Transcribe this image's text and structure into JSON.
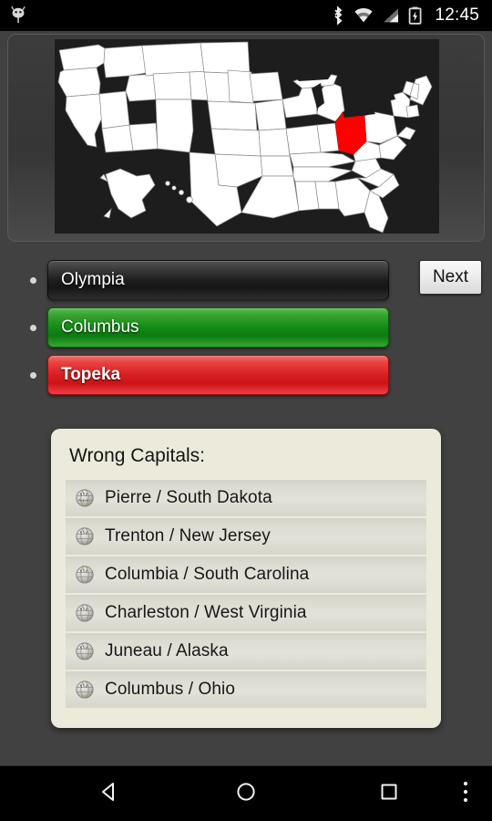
{
  "status_bar": {
    "notification_icon": "android-robot-icon",
    "icons": [
      "bluetooth-icon",
      "wifi-icon",
      "cellular-signal-icon",
      "battery-charging-icon"
    ],
    "clock": "12:45"
  },
  "map": {
    "name": "us-states-map",
    "highlighted_state": "Ohio",
    "highlight_color": "#FF0000",
    "state_fill": "#FFFFFF",
    "state_border": "#8a8a8a",
    "background_color": "#1d1d1d"
  },
  "answers": [
    {
      "label": "Olympia",
      "state": "neutral"
    },
    {
      "label": "Columbus",
      "state": "correct"
    },
    {
      "label": "Topeka",
      "state": "wrong"
    }
  ],
  "next_button": {
    "label": "Next"
  },
  "wrong_capitals": {
    "title": "Wrong Capitals:",
    "items": [
      {
        "label": "Pierre / South Dakota"
      },
      {
        "label": "Trenton / New Jersey"
      },
      {
        "label": "Columbia / South Carolina"
      },
      {
        "label": "Charleston / West Virginia"
      },
      {
        "label": "Juneau / Alaska"
      },
      {
        "label": "Columbus / Ohio"
      }
    ],
    "item_icon": "wikipedia-globe-icon"
  },
  "navigation_bar": {
    "back": "back-icon",
    "home": "home-icon",
    "recents": "recents-icon",
    "menu": "overflow-menu-icon"
  },
  "colors": {
    "background": "#414141",
    "panel": "#ecebdb",
    "correct": "#138b15",
    "wrong": "#d81f23"
  }
}
